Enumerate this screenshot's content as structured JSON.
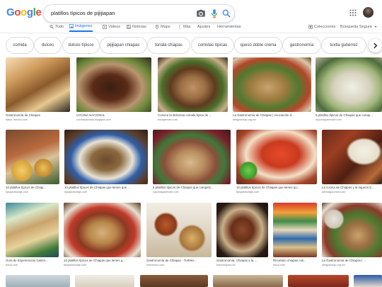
{
  "search": {
    "query": "platillos típicos de pijijiapan"
  },
  "logo": {
    "letters": [
      "G",
      "o",
      "o",
      "g",
      "l",
      "e"
    ],
    "colors": [
      "#4285f4",
      "#ea4335",
      "#fbbc05",
      "#4285f4",
      "#34a853",
      "#ea4335"
    ]
  },
  "tabs": [
    {
      "label": "Todo",
      "icon": "search-icon",
      "active": false
    },
    {
      "label": "Imágenes",
      "icon": "image-icon",
      "active": true
    },
    {
      "label": "Videos",
      "icon": "video-icon",
      "active": false
    },
    {
      "label": "Noticias",
      "icon": "news-icon",
      "active": false
    },
    {
      "label": "Maps",
      "icon": "map-pin-icon",
      "active": false
    },
    {
      "label": "Más",
      "icon": "more-vertical-icon",
      "active": false
    },
    {
      "label": "Ajustes",
      "icon": "",
      "active": false
    },
    {
      "label": "Herramientas",
      "icon": "",
      "active": false
    }
  ],
  "right_tabs": [
    {
      "label": "Colecciones",
      "icon": "collections-icon"
    },
    {
      "label": "Búsqueda Segura",
      "icon": "chevron-down-icon"
    }
  ],
  "chips": [
    "comida",
    "dulces",
    "dulces típicos",
    "pijijiapan chiapas",
    "tonalá chiapas",
    "comidas típicas",
    "queso doble crema",
    "gastronomía",
    "tuxtla gutiérrez"
  ],
  "accent": "#1a73e8",
  "results": [
    {
      "caption": "Gastronomía de Chiapas",
      "source": "sabor-mexico.com"
    },
    {
      "caption": "COCINA NACIONAL",
      "source": "cocinanacional.blogspot.com"
    },
    {
      "caption": "Conoce la deliciosa comida típica de ...",
      "source": "escapeman.com"
    },
    {
      "caption": "La Gastronomía de Chiapas | Asociación d...",
      "source": "amigoschap.org.mx"
    },
    {
      "caption": "5 platillos típicos de Chiapas que conqu...",
      "source": "soychiapanecote.com"
    },
    {
      "caption": "10 platillos típicos de Chiap...",
      "source": "tipsparaturiaje.com"
    },
    {
      "caption": "10 platillos típicos de Chiapas que tienes que ...",
      "source": "tipsparaturiaje.com"
    },
    {
      "caption": "5 platillos típicos de Chiapas que conquist...",
      "source": "soychiapanecote.com"
    },
    {
      "caption": "10 platillos típicos de Chiapas que tienes qu...",
      "source": "tipsparaturiaje.com"
    },
    {
      "caption": "La cocina de Chiapas y la riqueza d...",
      "source": "animalgourmet.com"
    },
    {
      "caption": "Guía de Experiencias Gastro...",
      "source": "issuu.com"
    },
    {
      "caption": "10 platillos típicos de Chiapas que tienes q...",
      "source": "tipsparaturiaje.com"
    },
    {
      "caption": "Gastronomía de Chiapas - TurMex...",
      "source": "turimexico.com"
    },
    {
      "caption": "Gastronomía. Chiapas a la ...",
      "source": "todochiapas.mx"
    },
    {
      "caption": "Recetario chiapas culi...",
      "source": "issuu.com"
    },
    {
      "caption": "La Gastronomía de Chiapas | ...",
      "source": "amigoschap.org.mx"
    }
  ]
}
